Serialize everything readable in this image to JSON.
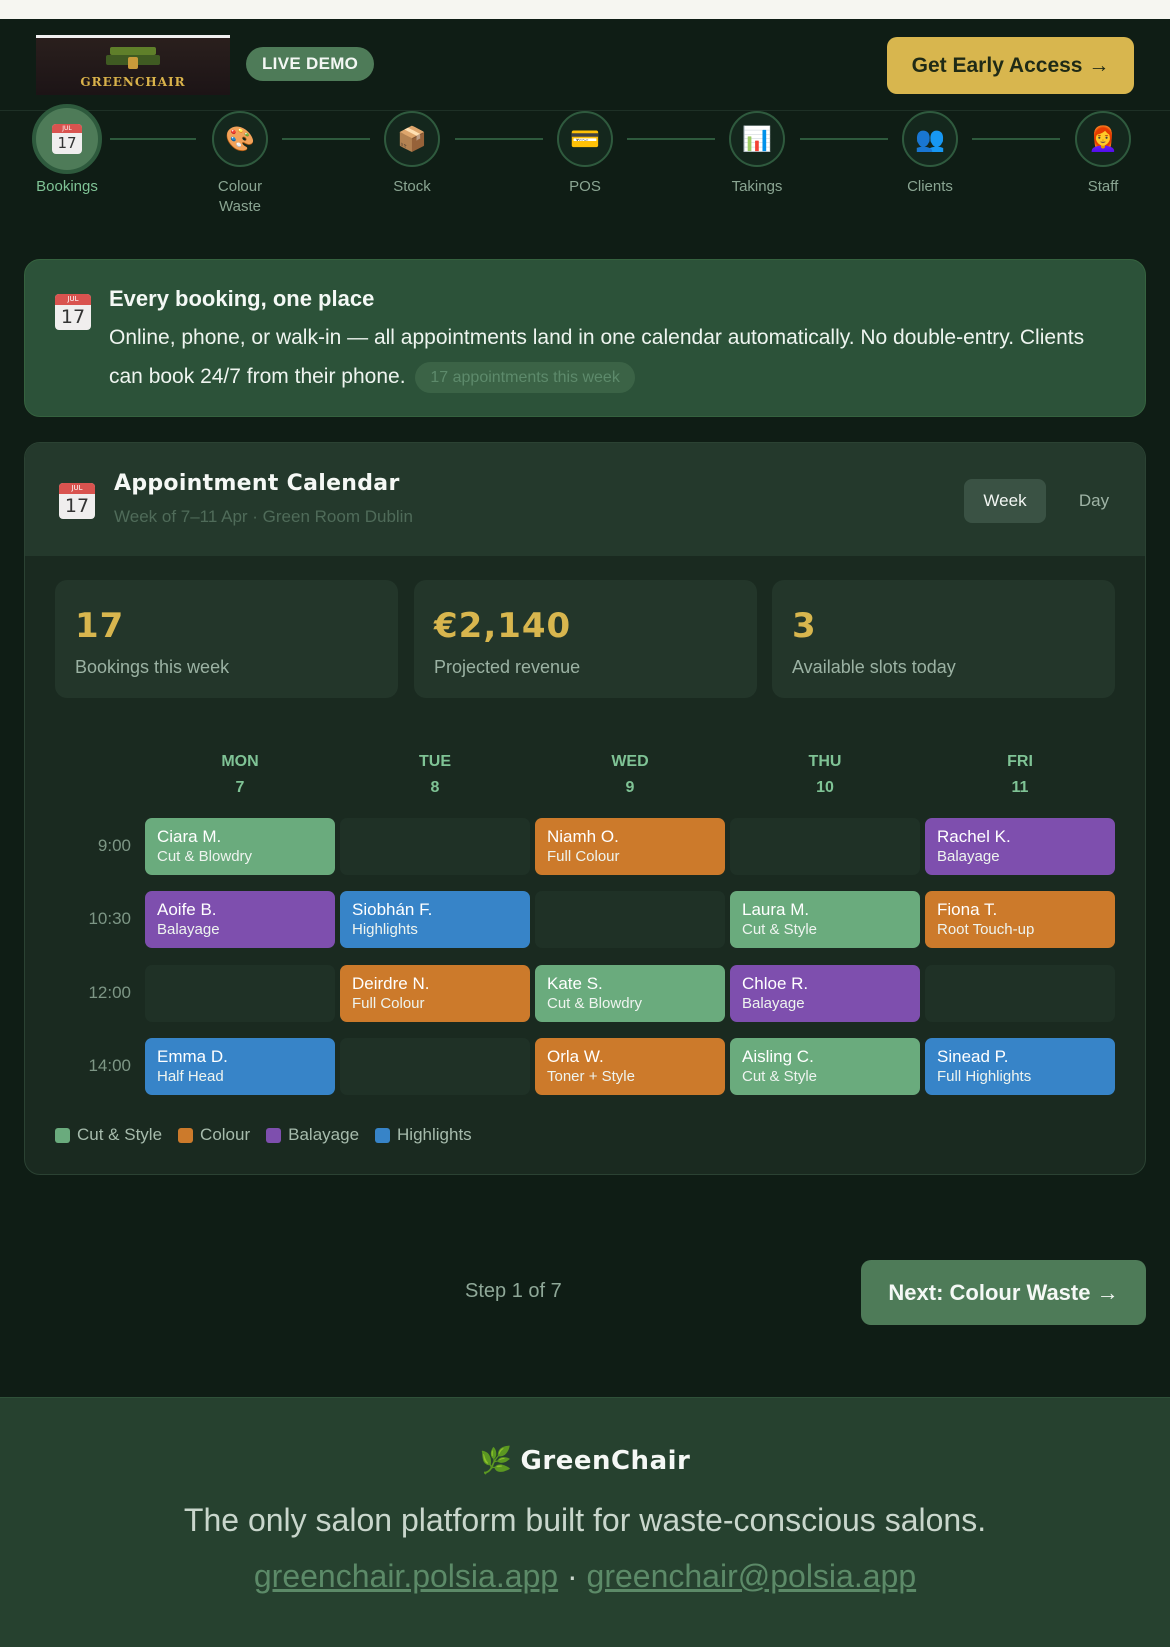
{
  "header": {
    "logo_text": "GREENCHAIR",
    "live_badge": "LIVE DEMO",
    "cta_label": "Get Early Access →"
  },
  "steps": [
    {
      "label": "Bookings",
      "icon": "📅"
    },
    {
      "label": "Colour Waste",
      "icon": "🎨"
    },
    {
      "label": "Stock",
      "icon": "📦"
    },
    {
      "label": "POS",
      "icon": "💳"
    },
    {
      "label": "Takings",
      "icon": "📊"
    },
    {
      "label": "Clients",
      "icon": "👥"
    },
    {
      "label": "Staff",
      "icon": "👩‍🦰"
    }
  ],
  "intro": {
    "title": "Every booking, one place",
    "body": "Online, phone, or walk-in — all appointments land in one calendar automatically. No double-entry. Clients can book 24/7 from their phone.",
    "pill": "17 appointments this week"
  },
  "calendar": {
    "title": "Appointment Calendar",
    "subtitle": "Week of 7–11 Apr · Green Room Dublin",
    "view_week": "Week",
    "view_day": "Day",
    "icon_month": "JUL",
    "icon_day": "17",
    "stats": [
      {
        "value": "17",
        "caption": "Bookings this week"
      },
      {
        "value": "€2,140",
        "caption": "Projected revenue"
      },
      {
        "value": "3",
        "caption": "Available slots today"
      }
    ],
    "days": [
      {
        "name": "MON",
        "num": "7"
      },
      {
        "name": "TUE",
        "num": "8"
      },
      {
        "name": "WED",
        "num": "9"
      },
      {
        "name": "THU",
        "num": "10"
      },
      {
        "name": "FRI",
        "num": "11"
      }
    ],
    "times": [
      "9:00",
      "10:30",
      "12:00",
      "14:00"
    ],
    "rows": [
      [
        {
          "name": "Ciara M.",
          "service": "Cut & Blowdry",
          "type": "cut"
        },
        null,
        {
          "name": "Niamh O.",
          "service": "Full Colour",
          "type": "colour"
        },
        null,
        {
          "name": "Rachel K.",
          "service": "Balayage",
          "type": "balayage"
        }
      ],
      [
        {
          "name": "Aoife B.",
          "service": "Balayage",
          "type": "balayage"
        },
        {
          "name": "Siobhán F.",
          "service": "Highlights",
          "type": "highlights"
        },
        null,
        {
          "name": "Laura M.",
          "service": "Cut & Style",
          "type": "cut"
        },
        {
          "name": "Fiona T.",
          "service": "Root Touch-up",
          "type": "colour"
        }
      ],
      [
        null,
        {
          "name": "Deirdre N.",
          "service": "Full Colour",
          "type": "colour"
        },
        {
          "name": "Kate S.",
          "service": "Cut & Blowdry",
          "type": "cut"
        },
        {
          "name": "Chloe R.",
          "service": "Balayage",
          "type": "balayage"
        },
        null
      ],
      [
        {
          "name": "Emma D.",
          "service": "Half Head",
          "type": "highlights"
        },
        null,
        {
          "name": "Orla W.",
          "service": "Toner + Style",
          "type": "colour"
        },
        {
          "name": "Aisling C.",
          "service": "Cut & Style",
          "type": "cut"
        },
        {
          "name": "Sinead P.",
          "service": "Full Highlights",
          "type": "highlights"
        }
      ]
    ],
    "legend": [
      {
        "label": "Cut & Style",
        "type": "cut"
      },
      {
        "label": "Colour",
        "type": "colour"
      },
      {
        "label": "Balayage",
        "type": "balayage"
      },
      {
        "label": "Highlights",
        "type": "highlights"
      }
    ],
    "colors": {
      "cut": "#6aab7d",
      "colour": "#cc7a2b",
      "balayage": "#7e4fae",
      "highlights": "#3784c8"
    }
  },
  "nav": {
    "step_count": "Step 1 of 7",
    "next_label": "Next: Colour Waste →"
  },
  "footer": {
    "brand": "GreenChair",
    "tagline": "The only salon platform built for waste-conscious salons.",
    "link_site": "greenchair.polsia.app",
    "separator": "·",
    "link_email": "greenchair@polsia.app"
  }
}
